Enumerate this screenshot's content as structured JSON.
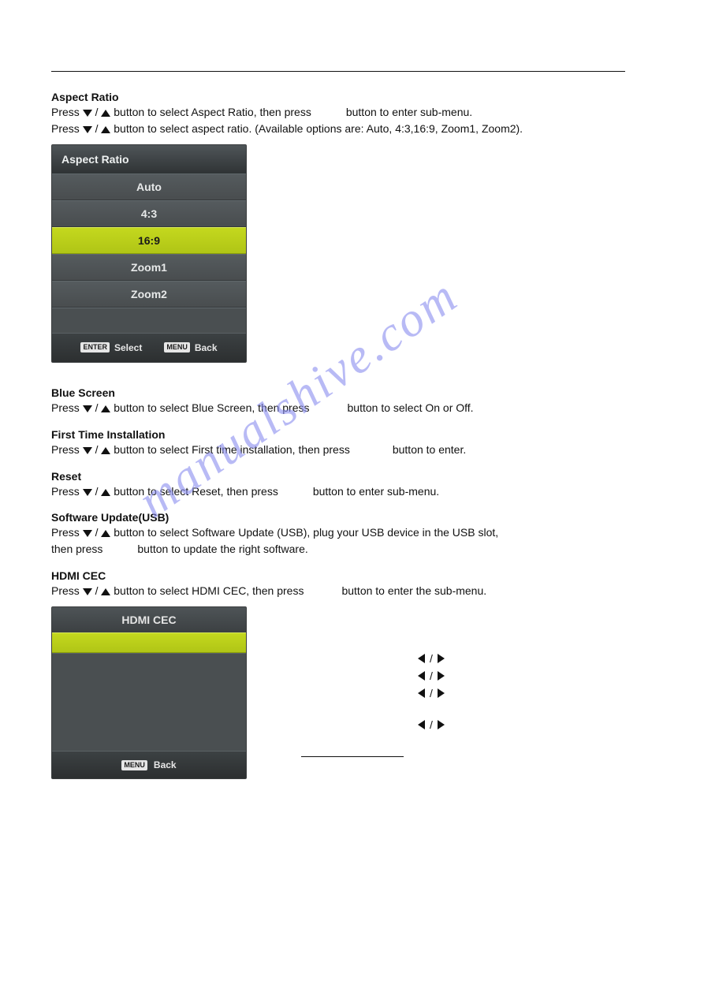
{
  "watermark": "manualshive.com",
  "sections": {
    "aspect": {
      "title": "Aspect Ratio",
      "line1a": "Press ",
      "line1b": " / ",
      "line1c": " button to select Aspect Ratio,  then press",
      "line1d": "button to enter sub-menu.",
      "line2a": "Press ",
      "line2b": " / ",
      "line2c": " button to select aspect ratio. (Available options are: Auto, 4:3,16:9, Zoom1, Zoom2)."
    },
    "blue": {
      "title": "Blue Screen",
      "a": "Press ",
      "b": " / ",
      "c": " button to select Blue Screen, then press",
      "d": "button to select On or Off."
    },
    "first": {
      "title": "First Time Installation",
      "a": "Press ",
      "b": " / ",
      "c": " button to select First time installation,  then press",
      "d": "button to enter."
    },
    "reset": {
      "title": "Reset",
      "a": "Press ",
      "b": " / ",
      "c": " button to select Reset,  then press",
      "d": "button to enter sub-menu."
    },
    "sw": {
      "title": "Software Update(USB)",
      "a": "Press ",
      "b": " / ",
      "c": " button to select Software Update (USB), plug your USB device in the USB slot,",
      "d": "then press",
      "e": "button to update the right software."
    },
    "cec": {
      "title": "HDMI CEC",
      "a": "Press ",
      "b": " / ",
      "c": " button to select HDMI CEC,  then press",
      "d": "button to enter the sub-menu."
    }
  },
  "menu1": {
    "title": "Aspect Ratio",
    "items": [
      "Auto",
      "4:3",
      "16:9",
      "Zoom1",
      "Zoom2"
    ],
    "selectedIndex": 2,
    "footer": {
      "enterKey": "ENTER",
      "enterLabel": "Select",
      "menuKey": "MENU",
      "menuLabel": "Back"
    }
  },
  "menu2": {
    "title": "HDMI CEC",
    "footer": {
      "menuKey": "MENU",
      "menuLabel": "Back"
    }
  },
  "lr_col_sep": " / "
}
